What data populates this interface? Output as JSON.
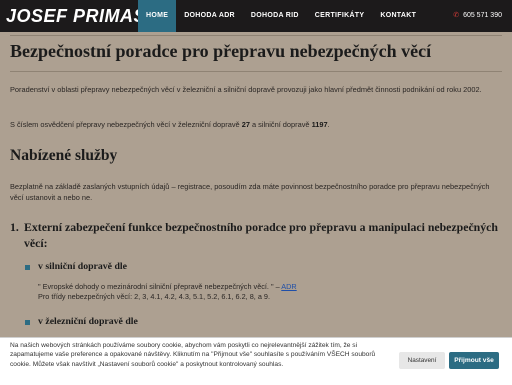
{
  "header": {
    "logo": "JOSEF PRIMAS",
    "nav": [
      {
        "label": "HOME",
        "active": true
      },
      {
        "label": "DOHODA ADR",
        "active": false
      },
      {
        "label": "DOHODA RID",
        "active": false
      },
      {
        "label": "CERTIFIKÁTY",
        "active": false
      },
      {
        "label": "KONTAKT",
        "active": false
      }
    ],
    "phone_icon": "phone-icon",
    "phone": "605 571 390"
  },
  "main": {
    "title": "Bezpečnostní poradce pro přepravu nebezpečných věcí",
    "intro": "Poradenství v oblasti přepravy nebezpečných věcí v železniční a silniční dopravě provozuji jako hlavní předmět činnosti podnikání od roku 2002.",
    "cert_prefix": "S číslem osvědčení přepravy nebezpečných věcí v železniční dopravě ",
    "cert_rail": "27",
    "cert_middle": " a silniční dopravě ",
    "cert_road": "1197",
    "cert_suffix": ".",
    "services_heading": "Nabízené služby",
    "services_intro": "Bezplatně na základě zaslaných vstupních údajů – registrace, posoudím zda máte povinnost bezpečnostního poradce pro přepravu nebezpečných věcí ustanovit a nebo ne.",
    "item1_number": "1.",
    "item1_title": "Externí zabezpečení funkce bezpečnostního poradce pro přepravu a manipulaci nebezpečných věcí:",
    "road_heading": "v silniční dopravě dle",
    "road_quote": "\" Evropské dohody o mezinárodní silniční přepravě nebezpečných věcí. \" – ",
    "road_link": "ADR",
    "road_classes": "Pro třídy nebezpečných věcí: 2, 3, 4.1, 4.2, 4.3, 5.1, 5.2, 6.1, 6.2, 8, a 9.",
    "rail_heading": "v železniční dopravě dle"
  },
  "cookie": {
    "text": "Na našich webových stránkách používáme soubory cookie, abychom vám poskytli co nejrelevantnější zážitek tím, že si zapamatujeme vaše preference a opakované návštěvy. Kliknutím na \"Přijmout vše\" souhlasíte s používáním VŠECH souborů cookie. Můžete však navštívit „Nastavení souborů cookie\" a poskytnout kontrolovaný souhlas.",
    "settings_label": "Nastavení",
    "accept_label": "Přijmout vše"
  },
  "colors": {
    "accent": "#2c6c83",
    "content_bg": "#ada091",
    "header_bg": "#1c1a1b",
    "phone_icon": "#d23b38"
  }
}
